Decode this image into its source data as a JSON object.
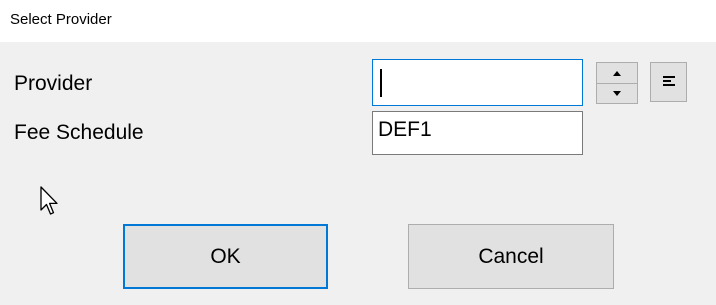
{
  "window": {
    "title": "Select Provider"
  },
  "form": {
    "provider_label": "Provider",
    "provider_value": "",
    "fee_schedule_label": "Fee Schedule",
    "fee_schedule_value": "DEF1"
  },
  "icons": {
    "spin_up": "chevron-up-icon",
    "spin_down": "chevron-down-icon",
    "list": "list-icon",
    "cursor": "mouse-pointer-icon"
  },
  "buttons": {
    "ok_label": "OK",
    "cancel_label": "Cancel"
  },
  "colors": {
    "focus_accent": "#0078d7",
    "button_face": "#e1e1e1",
    "dialog_background": "#f0f0f0"
  }
}
